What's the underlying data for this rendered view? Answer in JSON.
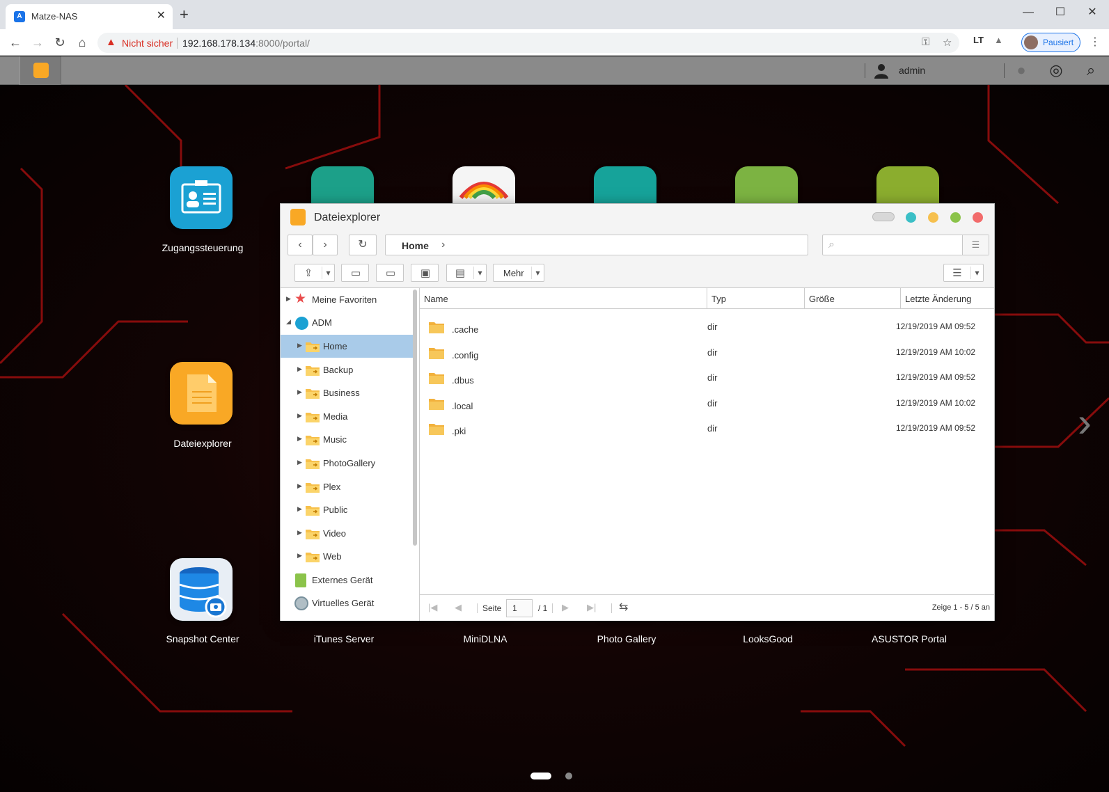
{
  "browser": {
    "tab_title": "Matze-NAS",
    "favicon_label": "A",
    "not_secure_label": "Nicht sicher",
    "url_host": "192.168.178.134",
    "url_rest": ":8000/portal/",
    "profile_label": "Pausiert",
    "ext_label": "LT"
  },
  "adm": {
    "user": "admin"
  },
  "desktop": {
    "apps": [
      {
        "label": "Zugangssteuerung",
        "color": "#1ba1d3"
      },
      {
        "label": "Dateiexplorer",
        "color": "#f9a825"
      },
      {
        "label": "Snapshot Center",
        "color": "#e8eef5"
      },
      {
        "label": "iTunes Server",
        "color": "#e05a3a"
      },
      {
        "label": "MiniDLNA",
        "color": "#7cb342"
      },
      {
        "label": "Photo Gallery",
        "color": "#f0a030"
      },
      {
        "label": "LooksGood",
        "color": "#1e88e5"
      },
      {
        "label": "ASUSTOR Portal",
        "color": "#455a64"
      }
    ]
  },
  "explorer": {
    "title": "Dateiexplorer",
    "breadcrumb": "Home",
    "search_placeholder": "",
    "more_label": "Mehr",
    "tree": {
      "favorites": "Meine Favoriten",
      "adm": "ADM",
      "folders": [
        "Home",
        "Backup",
        "Business",
        "Media",
        "Music",
        "PhotoGallery",
        "Plex",
        "Public",
        "Video",
        "Web"
      ],
      "external": "Externes Gerät",
      "virtual": "Virtuelles Gerät"
    },
    "columns": {
      "name": "Name",
      "type": "Typ",
      "size": "Größe",
      "modified": "Letzte Änderung"
    },
    "files": [
      {
        "name": ".cache",
        "type": "dir",
        "size": "",
        "modified": "12/19/2019 AM 09:52"
      },
      {
        "name": ".config",
        "type": "dir",
        "size": "",
        "modified": "12/19/2019 AM 10:02"
      },
      {
        "name": ".dbus",
        "type": "dir",
        "size": "",
        "modified": "12/19/2019 AM 09:52"
      },
      {
        "name": ".local",
        "type": "dir",
        "size": "",
        "modified": "12/19/2019 AM 10:02"
      },
      {
        "name": ".pki",
        "type": "dir",
        "size": "",
        "modified": "12/19/2019 AM 09:52"
      }
    ],
    "pager": {
      "page_label": "Seite",
      "page_value": "1",
      "total_pages": "/ 1",
      "summary": "Zeige 1 - 5 / 5 an"
    }
  },
  "colors": {
    "accent_blue": "#1a73e8",
    "selection": "#a9cbe9",
    "folder": "#f7c04a",
    "win_teal": "#3bbfc6",
    "win_yellow": "#f6c04e",
    "win_green": "#8bc34a",
    "win_red": "#f26b6b"
  }
}
